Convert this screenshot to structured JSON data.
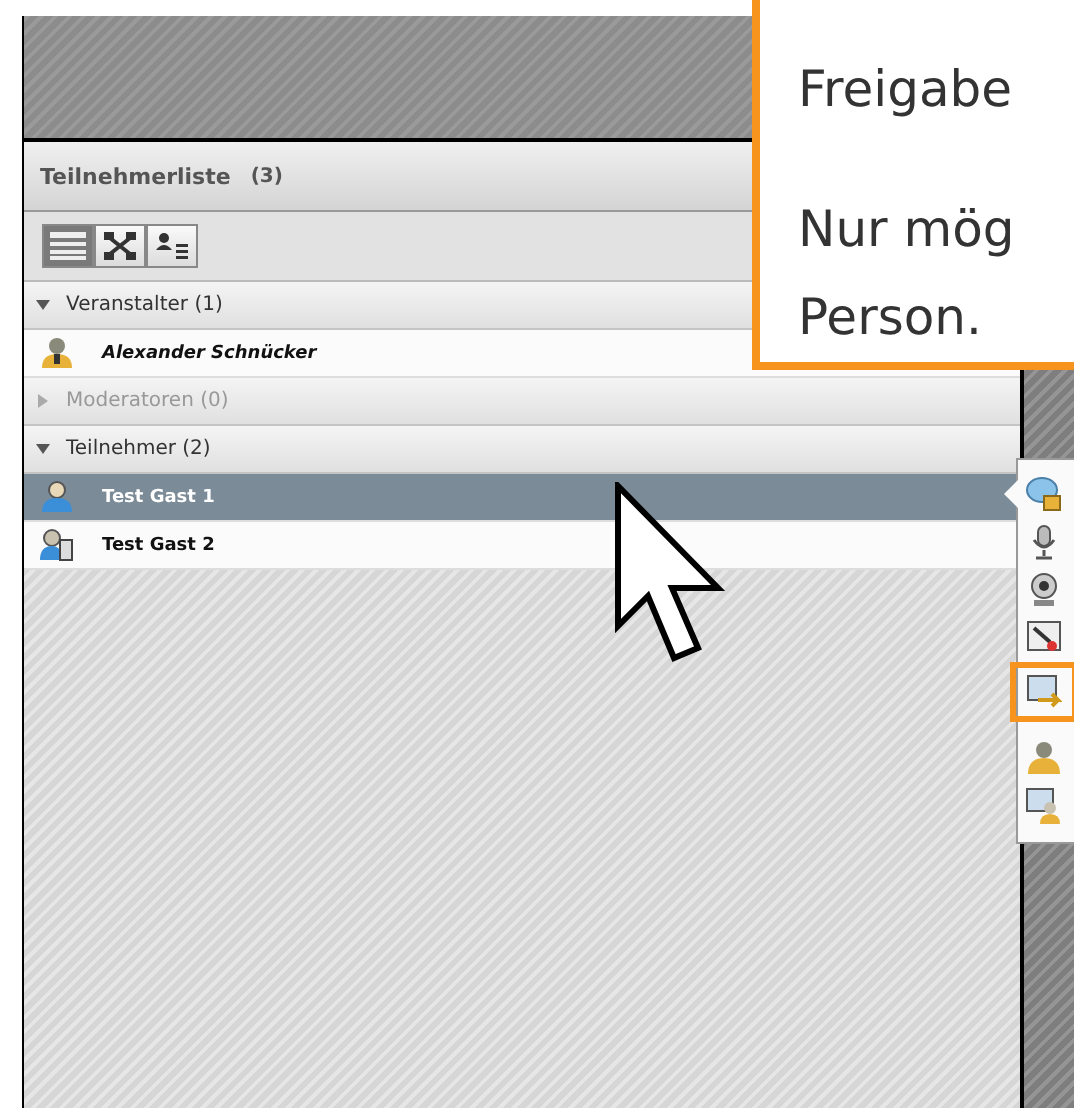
{
  "panel": {
    "title": "Teilnehmerliste",
    "count": "(3)",
    "view_buttons": [
      {
        "kind": "list",
        "selected": true
      },
      {
        "kind": "grid",
        "selected": false
      },
      {
        "kind": "detail",
        "selected": false
      }
    ],
    "groups": [
      {
        "label": "Veranstalter (1)",
        "expanded": true,
        "disabled": false,
        "members": [
          {
            "name": "Alexander Schnücker",
            "kind": "host",
            "selected": false
          }
        ]
      },
      {
        "label": "Moderatoren (0)",
        "expanded": false,
        "disabled": true
      },
      {
        "label": "Teilnehmer (2)",
        "expanded": true,
        "disabled": false,
        "members": [
          {
            "name": "Test Gast 1",
            "kind": "guest",
            "selected": true
          },
          {
            "name": "Test Gast 2",
            "kind": "guest-device",
            "selected": false
          }
        ]
      }
    ]
  },
  "popup_menu": {
    "items": [
      {
        "kind": "chat-lock",
        "highlighted": false
      },
      {
        "kind": "microphone",
        "highlighted": false
      },
      {
        "kind": "webcam",
        "highlighted": false
      },
      {
        "kind": "pointer",
        "highlighted": false
      },
      {
        "kind": "screen-share",
        "highlighted": true
      },
      {
        "kind": "host",
        "highlighted": false
      },
      {
        "kind": "presenter",
        "highlighted": false
      }
    ]
  },
  "callout": {
    "paragraphs": [
      [
        "Freigabe"
      ],
      [
        "Nur mög",
        "Person."
      ]
    ]
  }
}
